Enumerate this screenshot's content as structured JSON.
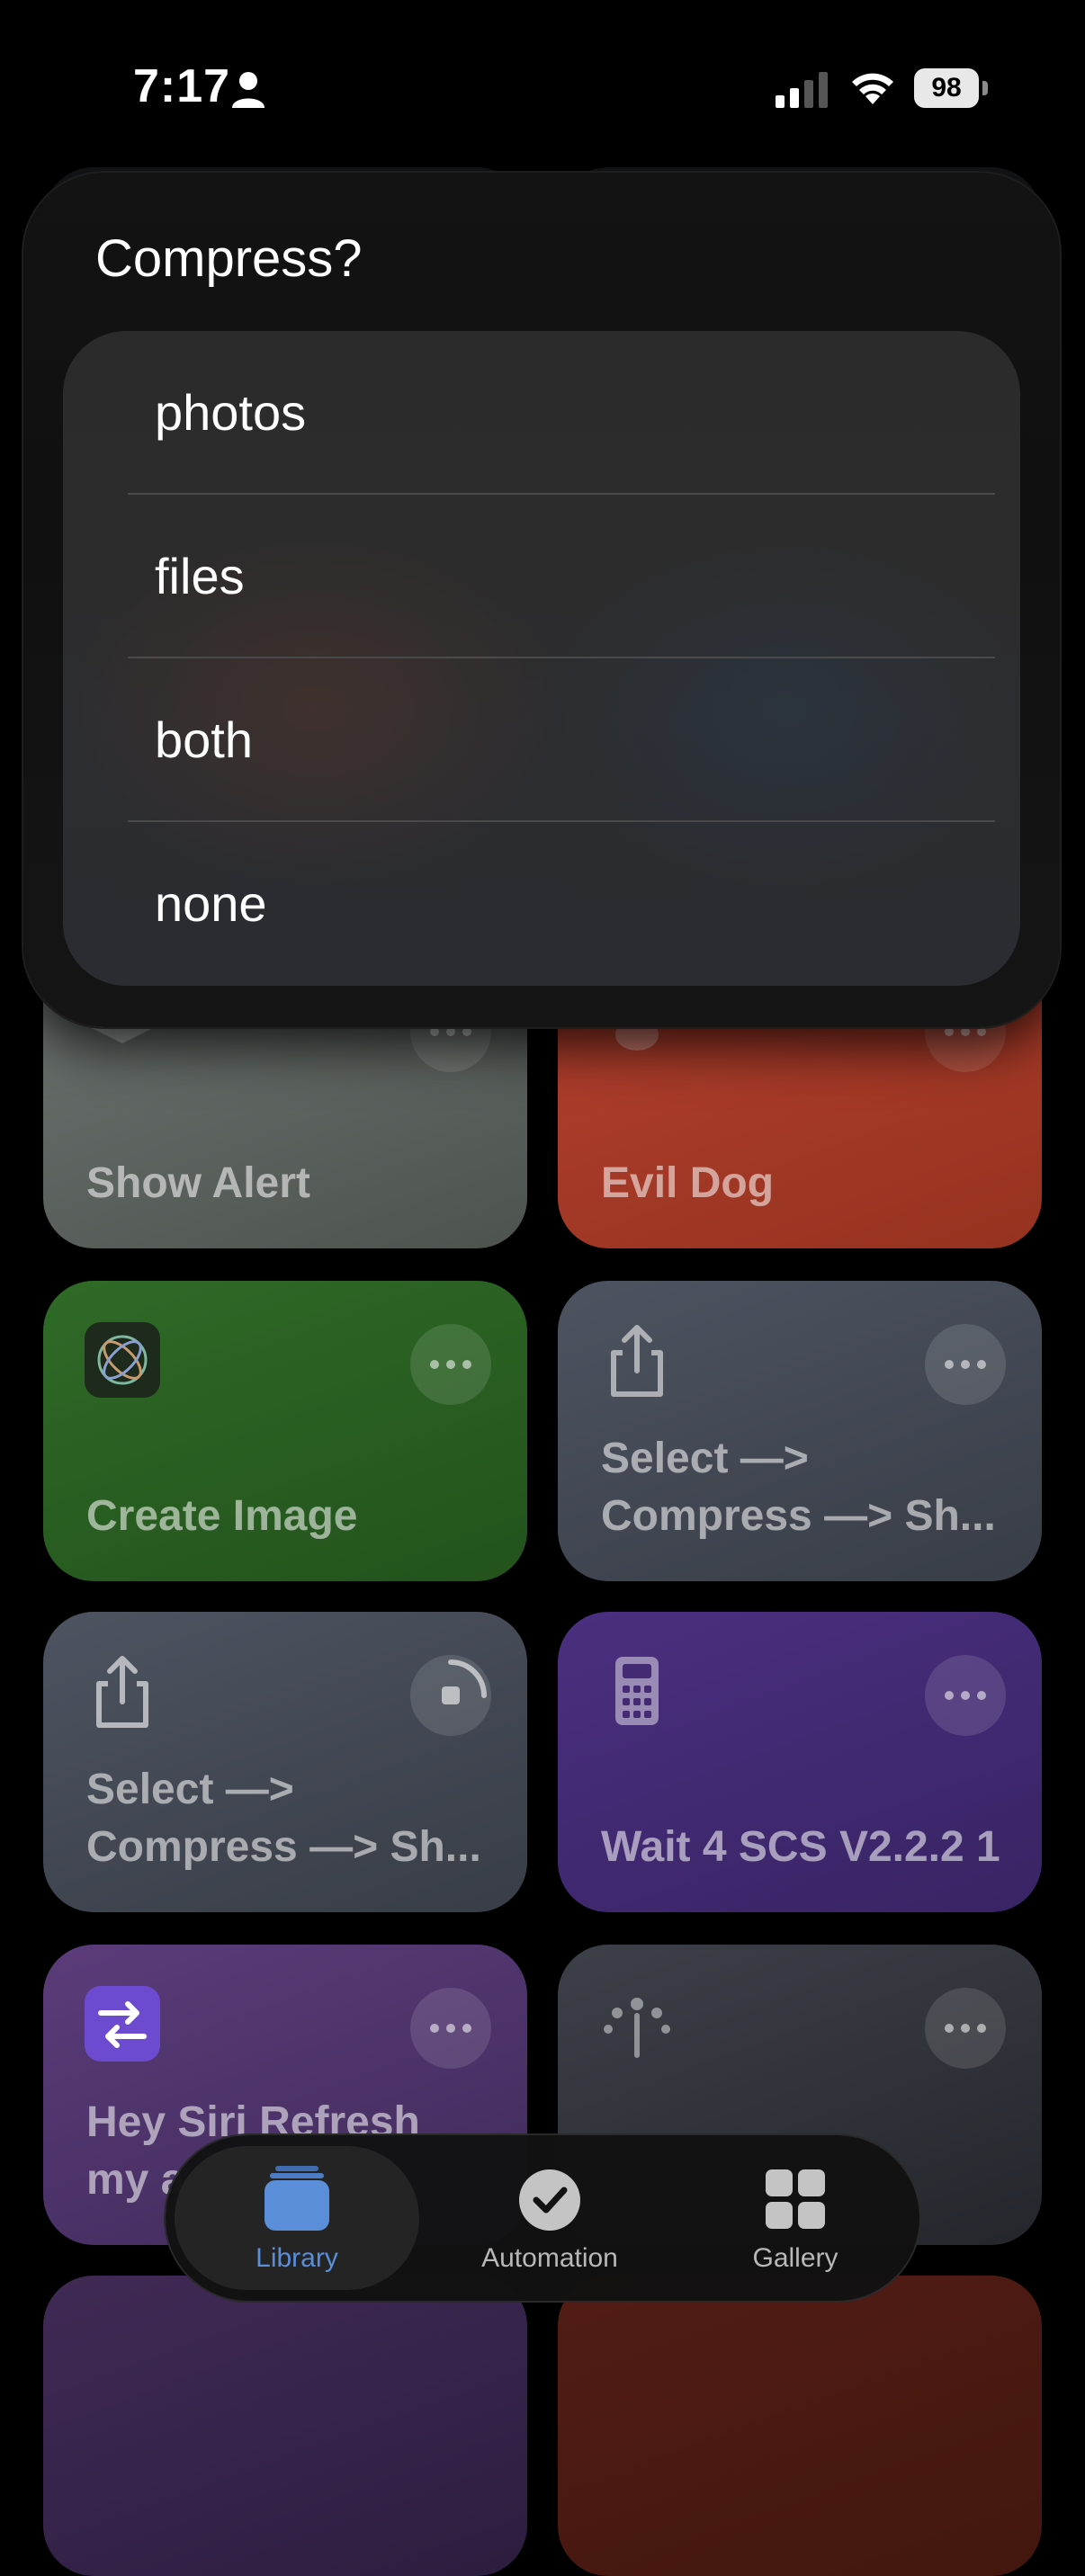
{
  "status_bar": {
    "time": "7:17",
    "battery": "98"
  },
  "menu": {
    "title": "Compress?",
    "options": [
      "photos",
      "files",
      "both",
      "none"
    ]
  },
  "shortcuts": [
    {
      "name": "Show Alert",
      "color": "#5f6662",
      "icon": "layers-icon"
    },
    {
      "name": "Evil Dog",
      "color": "#a63a29",
      "icon": "dog-icon"
    },
    {
      "name": "Create Image",
      "color": "#2a6022",
      "icon": "image-playground-icon"
    },
    {
      "name": "Select —> Compress —> Sh...",
      "color": "#454a55",
      "icon": "share-icon"
    },
    {
      "name": "Select —> Compress —> Sh...",
      "color": "#454a55",
      "icon": "share-icon",
      "running": true
    },
    {
      "name": "Wait 4 SCS V2.2.2 1",
      "color": "#432a72",
      "icon": "calculator-icon"
    },
    {
      "name": "Hey Siri Refresh my a",
      "color": "#4e3470",
      "icon": "shortcut-arrows-icon"
    },
    {
      "name": "",
      "color": "#3a3d44",
      "icon": "sprout-icon"
    }
  ],
  "tab_bar": {
    "tabs": [
      {
        "label": "Library",
        "icon": "library-icon",
        "active": true
      },
      {
        "label": "Automation",
        "icon": "automation-check-icon",
        "active": false
      },
      {
        "label": "Gallery",
        "icon": "gallery-grid-icon",
        "active": false
      }
    ]
  }
}
